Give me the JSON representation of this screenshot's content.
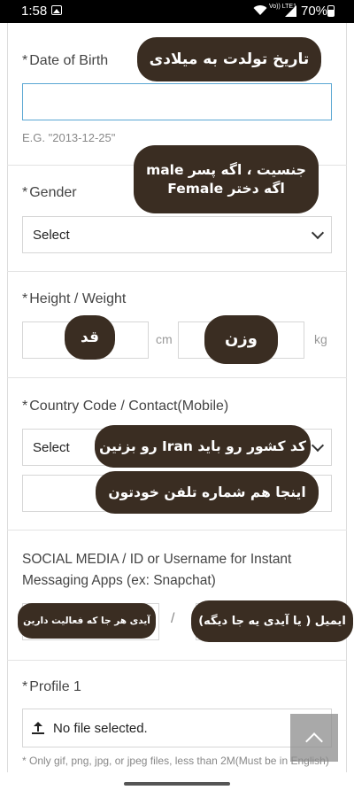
{
  "status_bar": {
    "time": "1:58",
    "network": "Vo)) LTE1",
    "battery": "70%"
  },
  "fields": {
    "dob": {
      "label": "Date of Birth",
      "value": "",
      "hint": "E.G. \"2013-12-25\""
    },
    "gender": {
      "label": "Gender",
      "selected": "Select"
    },
    "height_weight": {
      "label": "Height / Weight",
      "height_unit": "cm",
      "weight_unit": "kg",
      "height_value": "",
      "weight_value": ""
    },
    "contact": {
      "label": "Country Code / Contact(Mobile)",
      "country_selected": "Select",
      "phone_value": ""
    },
    "social": {
      "label": "SOCIAL MEDIA / ID or Username for Instant Messaging Apps (ex: Snapchat)",
      "separator": "/"
    },
    "profile": {
      "label": "Profile 1",
      "file_status": "No file selected.",
      "note": "* Only gif, png, jpg, or jpeg files, less than 2M(Must be in English)"
    }
  },
  "required_marker": "*",
  "annotations": {
    "dob": "تاریخ تولدت به میلادی",
    "gender_line1": "جنسیت ، اگه پسر male",
    "gender_line2": "اگه دختر Female",
    "height": "قد",
    "weight": "وزن",
    "country": "کد کشور رو باید Iran رو بزنین",
    "phone": "اینجا هم شماره تلفن خودتون",
    "social_id": "آیدی هر جا که فعالیت دارین",
    "social_email": "ایمیل ( یا آیدی یه جا دیگه)"
  },
  "colors": {
    "annotation_bg": "#3a2d22",
    "focus_border": "#5aa7d3"
  },
  "icons": {
    "upload": "upload-icon",
    "scroll_top": "chevron-up-icon",
    "select_arrow": "chevron-down-icon"
  }
}
